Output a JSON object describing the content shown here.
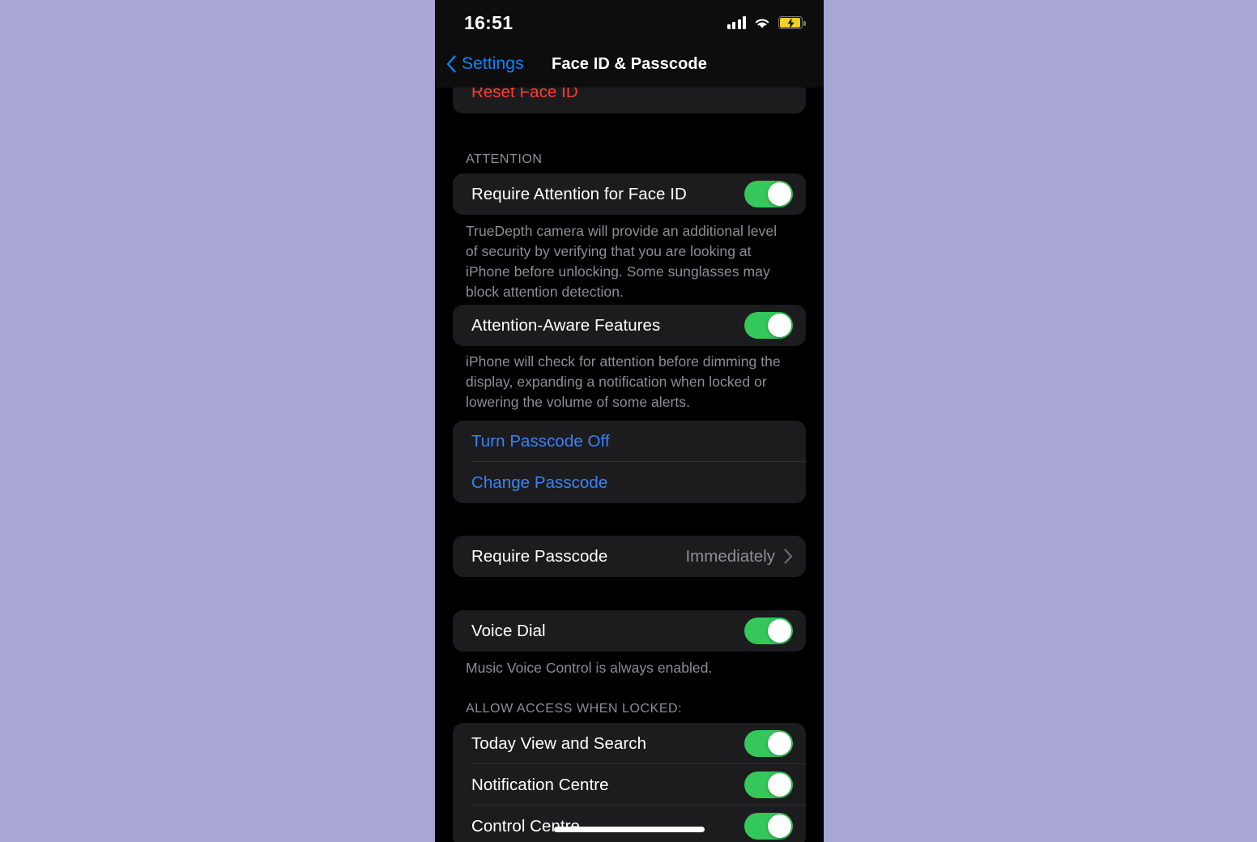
{
  "device": {
    "frame_background": "#a8a6d3",
    "screen_background": "#000000",
    "card_background": "#1c1c1e"
  },
  "status_bar": {
    "time": "16:51",
    "signal_icon": "cellular-signal-icon",
    "signal_bars_filled": 4,
    "wifi_icon": "wifi-icon",
    "battery_icon": "battery-charging-icon",
    "battery_color": "#f5d020",
    "battery_charging": true
  },
  "nav_bar": {
    "back_icon": "chevron-left-icon",
    "back_label": "Settings",
    "title": "Face ID & Passcode"
  },
  "sections": {
    "reset": {
      "rows": [
        {
          "label": "Reset Face ID",
          "style": "destructive"
        }
      ]
    },
    "attention": {
      "header": "ATTENTION",
      "rows": [
        {
          "label": "Require Attention for Face ID",
          "toggle": "on"
        }
      ],
      "footer": "TrueDepth camera will provide an additional level of security by verifying that you are looking at iPhone before unlocking. Some sunglasses may block attention detection."
    },
    "attention_aware": {
      "rows": [
        {
          "label": "Attention-Aware Features",
          "toggle": "on"
        }
      ],
      "footer": "iPhone will check for attention before dimming the display, expanding a notification when locked or lowering the volume of some alerts."
    },
    "passcode_actions": {
      "rows": [
        {
          "label": "Turn Passcode Off",
          "style": "action"
        },
        {
          "label": "Change Passcode",
          "style": "action"
        }
      ]
    },
    "require_passcode": {
      "rows": [
        {
          "label": "Require Passcode",
          "value": "Immediately",
          "accessory": "chevron-right-icon"
        }
      ]
    },
    "voice_dial": {
      "rows": [
        {
          "label": "Voice Dial",
          "toggle": "on"
        }
      ],
      "footer": "Music Voice Control is always enabled."
    },
    "allow_access": {
      "header": "ALLOW ACCESS WHEN LOCKED:",
      "rows": [
        {
          "label": "Today View and Search",
          "toggle": "on"
        },
        {
          "label": "Notification Centre",
          "toggle": "on"
        },
        {
          "label": "Control Centre",
          "toggle": "on"
        }
      ]
    }
  },
  "home_indicator": "home-indicator"
}
